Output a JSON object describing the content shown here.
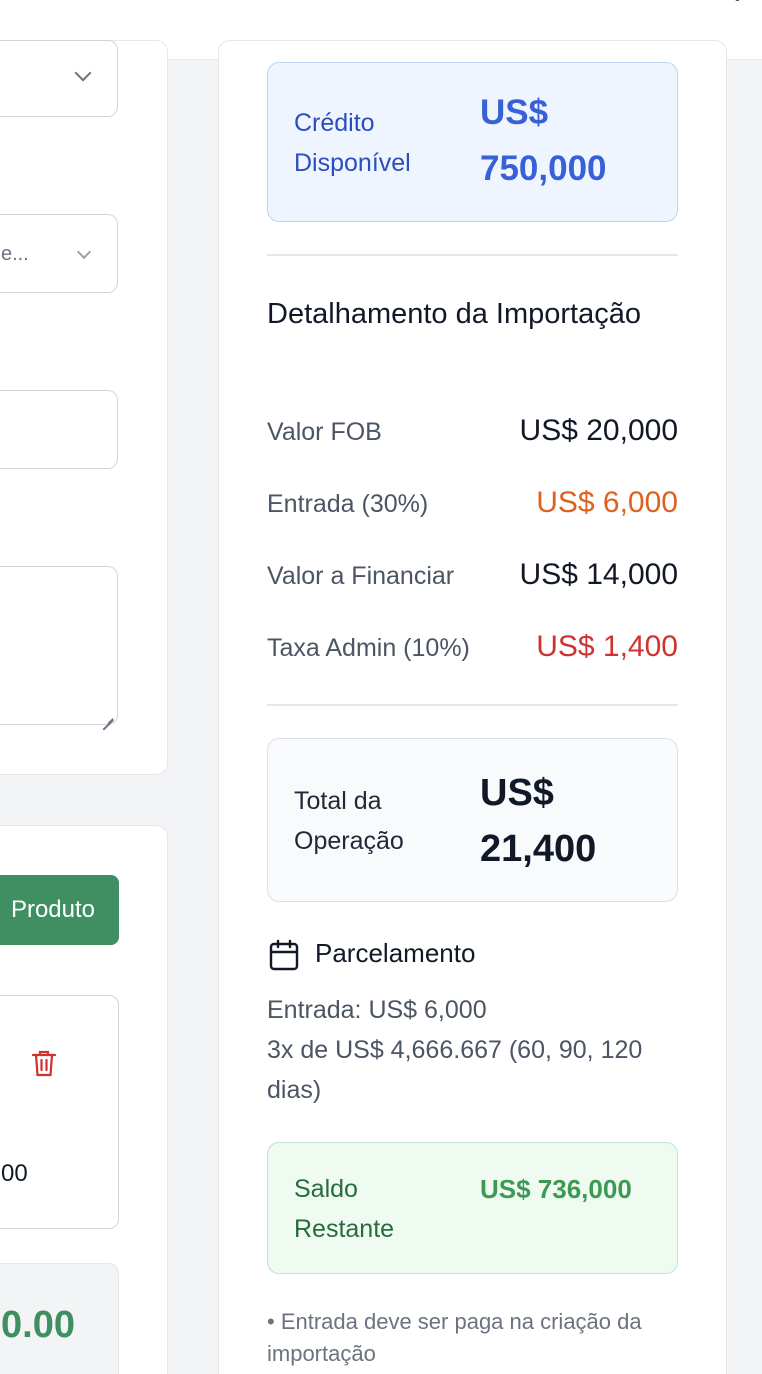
{
  "credit": {
    "label": "Crédito Disponível",
    "value": "US$ 750,000"
  },
  "breakdown": {
    "title": "Detalhamento da Importação",
    "rows": [
      {
        "label": "Valor FOB",
        "value": "US$ 20,000",
        "color": "#111827"
      },
      {
        "label": "Entrada (30%)",
        "value": "US$ 6,000",
        "color": "#e0601e"
      },
      {
        "label": "Valor a Financiar",
        "value": "US$ 14,000",
        "color": "#111827"
      },
      {
        "label": "Taxa Admin (10%)",
        "value": "US$ 1,400",
        "color": "#d0332f"
      }
    ]
  },
  "operation": {
    "label": "Total da Operação",
    "value": "US$ 21,400"
  },
  "installments": {
    "title": "Parcelamento",
    "icon": "calendar-icon",
    "line1": "Entrada: US$ 6,000",
    "line2": "3x de US$ 4,666.667 (60, 90, 120 dias)"
  },
  "balance": {
    "label": "Saldo Restante",
    "value": "US$ 736,000"
  },
  "note": "• Entrada deve ser paga na criação da importação",
  "left": {
    "select2_text": "e...",
    "add_product_label": "Produto",
    "product_value": "00",
    "total_value": "0.00"
  },
  "colors": {
    "accent_blue": "#3860d7",
    "accent_green": "#3f8f63",
    "danger": "#d0332f",
    "warning": "#e0601e"
  }
}
